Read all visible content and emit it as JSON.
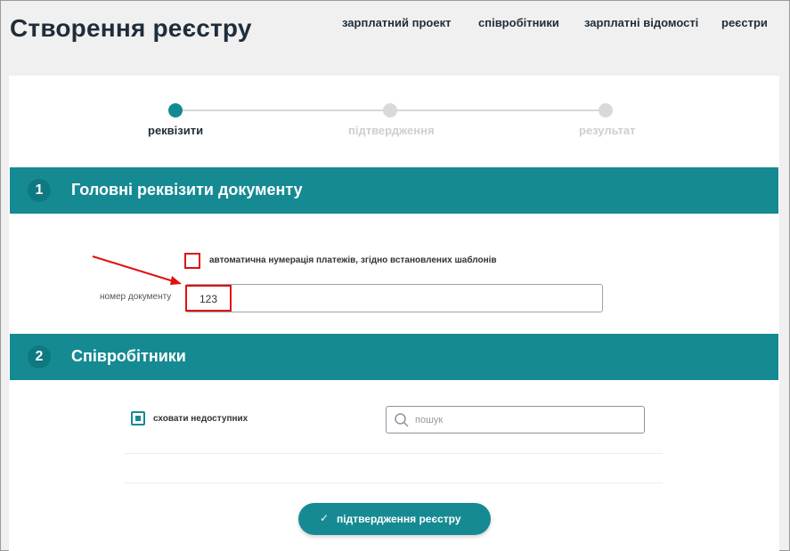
{
  "header": {
    "title": "Створення реєстру",
    "nav": [
      "зарплатний проект",
      "співробітники",
      "зарплатні відомості",
      "реєстри"
    ]
  },
  "stepper": {
    "steps": [
      {
        "label": "реквізити",
        "state": "active"
      },
      {
        "label": "підтвердження",
        "state": "inactive"
      },
      {
        "label": "результат",
        "state": "inactive"
      }
    ]
  },
  "section1": {
    "number": "1",
    "title": "Головні реквізити документу",
    "auto_numbering_label": "автоматична нумерація платежів, згідно встановлених шаблонів",
    "auto_numbering_checked": false,
    "doc_number_label": "номер документу",
    "doc_number_value": "123"
  },
  "section2": {
    "number": "2",
    "title": "Співробітники",
    "hide_unavailable_label": "сховати недоступних",
    "hide_unavailable_checked": true,
    "search_placeholder": "пошук"
  },
  "confirm_button": {
    "icon": "check-icon",
    "label": "підтвердження реєстру"
  },
  "colors": {
    "accent": "#168a92",
    "annotation": "#e01010",
    "inactive": "#d9d9d9"
  }
}
